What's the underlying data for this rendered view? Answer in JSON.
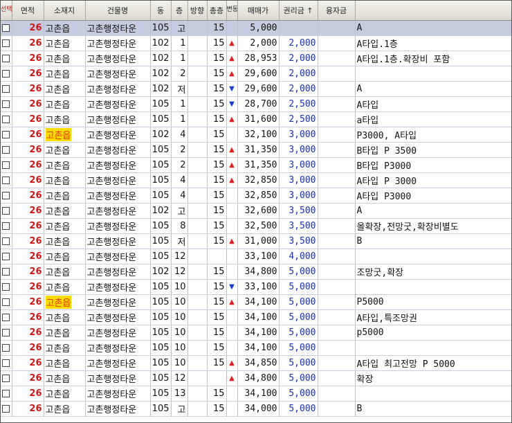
{
  "headers": {
    "select": "선택",
    "area": "면적",
    "location": "소재지",
    "building": "건물명",
    "dong": "동",
    "floor": "층",
    "direction": "방향",
    "total_floors": "총층",
    "trend": "변동",
    "sale_price": "매매가",
    "premium": "권리금 ↑",
    "loan": "융자금",
    "memo": ""
  },
  "colors": {
    "area_red": "#d01818",
    "premium_blue": "#1a2fb0",
    "highlight_yellow": "#ffdc00",
    "selected_row": "#c6cce0",
    "up_arrow": "#e02020",
    "down_arrow": "#1a3fd0"
  },
  "rows": [
    {
      "area": "26",
      "location": "고촌읍",
      "highlight": false,
      "building": "고촌행정타운",
      "dong": "105",
      "floor": "고",
      "direction": "",
      "total": "15",
      "trend": "",
      "price": "5,000",
      "premium": "",
      "loan": "",
      "memo": "A",
      "selected": true
    },
    {
      "area": "26",
      "location": "고촌읍",
      "highlight": false,
      "building": "고촌행정타운",
      "dong": "102",
      "floor": "1",
      "direction": "",
      "total": "15",
      "trend": "▲",
      "price": "2,000",
      "premium": "2,000",
      "loan": "",
      "memo": "A타입.1층",
      "selected": false
    },
    {
      "area": "26",
      "location": "고촌읍",
      "highlight": false,
      "building": "고촌행정타운",
      "dong": "102",
      "floor": "1",
      "direction": "",
      "total": "15",
      "trend": "▲",
      "price": "28,953",
      "premium": "2,000",
      "loan": "",
      "memo": "A타입.1층.확장비 포함",
      "selected": false
    },
    {
      "area": "26",
      "location": "고촌읍",
      "highlight": false,
      "building": "고촌행정타운",
      "dong": "102",
      "floor": "2",
      "direction": "",
      "total": "15",
      "trend": "▲",
      "price": "29,600",
      "premium": "2,000",
      "loan": "",
      "memo": "",
      "selected": false
    },
    {
      "area": "26",
      "location": "고촌읍",
      "highlight": false,
      "building": "고촌행정타운",
      "dong": "102",
      "floor": "저",
      "direction": "",
      "total": "15",
      "trend": "▼",
      "price": "29,600",
      "premium": "2,000",
      "loan": "",
      "memo": "A",
      "selected": false
    },
    {
      "area": "26",
      "location": "고촌읍",
      "highlight": false,
      "building": "고촌행정타운",
      "dong": "105",
      "floor": "1",
      "direction": "",
      "total": "15",
      "trend": "▼",
      "price": "28,700",
      "premium": "2,500",
      "loan": "",
      "memo": "A타입",
      "selected": false
    },
    {
      "area": "26",
      "location": "고촌읍",
      "highlight": false,
      "building": "고촌행정타운",
      "dong": "105",
      "floor": "1",
      "direction": "",
      "total": "15",
      "trend": "▲",
      "price": "31,600",
      "premium": "2,500",
      "loan": "",
      "memo": "a타입",
      "selected": false
    },
    {
      "area": "26",
      "location": "고촌읍",
      "highlight": true,
      "building": "고촌행정타운",
      "dong": "102",
      "floor": "4",
      "direction": "",
      "total": "15",
      "trend": "",
      "price": "32,100",
      "premium": "3,000",
      "loan": "",
      "memo": "P3000, A타입",
      "selected": false
    },
    {
      "area": "26",
      "location": "고촌읍",
      "highlight": false,
      "building": "고촌행정타운",
      "dong": "105",
      "floor": "2",
      "direction": "",
      "total": "15",
      "trend": "▲",
      "price": "31,350",
      "premium": "3,000",
      "loan": "",
      "memo": "B타입  P 3500",
      "selected": false
    },
    {
      "area": "26",
      "location": "고촌읍",
      "highlight": false,
      "building": "고촌행정타운",
      "dong": "105",
      "floor": "2",
      "direction": "",
      "total": "15",
      "trend": "▲",
      "price": "31,350",
      "premium": "3,000",
      "loan": "",
      "memo": "B타입 P3000",
      "selected": false
    },
    {
      "area": "26",
      "location": "고촌읍",
      "highlight": false,
      "building": "고촌행정타운",
      "dong": "105",
      "floor": "4",
      "direction": "",
      "total": "15",
      "trend": "▲",
      "price": "32,850",
      "premium": "3,000",
      "loan": "",
      "memo": "A타입  P 3000",
      "selected": false
    },
    {
      "area": "26",
      "location": "고촌읍",
      "highlight": false,
      "building": "고촌행정타운",
      "dong": "105",
      "floor": "4",
      "direction": "",
      "total": "15",
      "trend": "",
      "price": "32,850",
      "premium": "3,000",
      "loan": "",
      "memo": "A타입 P3000",
      "selected": false
    },
    {
      "area": "26",
      "location": "고촌읍",
      "highlight": false,
      "building": "고촌행정타운",
      "dong": "102",
      "floor": "고",
      "direction": "",
      "total": "15",
      "trend": "",
      "price": "32,600",
      "premium": "3,500",
      "loan": "",
      "memo": "A",
      "selected": false
    },
    {
      "area": "26",
      "location": "고촌읍",
      "highlight": false,
      "building": "고촌행정타운",
      "dong": "105",
      "floor": "8",
      "direction": "",
      "total": "15",
      "trend": "",
      "price": "32,500",
      "premium": "3,500",
      "loan": "",
      "memo": "올확장,전망굿,확장비별도",
      "selected": false
    },
    {
      "area": "26",
      "location": "고촌읍",
      "highlight": false,
      "building": "고촌행정타운",
      "dong": "105",
      "floor": "저",
      "direction": "",
      "total": "15",
      "trend": "▲",
      "price": "31,000",
      "premium": "3,500",
      "loan": "",
      "memo": "B",
      "selected": false
    },
    {
      "area": "26",
      "location": "고촌읍",
      "highlight": false,
      "building": "고촌행정타운",
      "dong": "105",
      "floor": "12",
      "direction": "",
      "total": "",
      "trend": "",
      "price": "33,100",
      "premium": "4,000",
      "loan": "",
      "memo": "",
      "selected": false
    },
    {
      "area": "26",
      "location": "고촌읍",
      "highlight": false,
      "building": "고촌행정타운",
      "dong": "102",
      "floor": "12",
      "direction": "",
      "total": "15",
      "trend": "",
      "price": "34,800",
      "premium": "5,000",
      "loan": "",
      "memo": "조망굿,확장",
      "selected": false
    },
    {
      "area": "26",
      "location": "고촌읍",
      "highlight": false,
      "building": "고촌행정타운",
      "dong": "105",
      "floor": "10",
      "direction": "",
      "total": "15",
      "trend": "▼",
      "price": "33,100",
      "premium": "5,000",
      "loan": "",
      "memo": "",
      "selected": false
    },
    {
      "area": "26",
      "location": "고촌읍",
      "highlight": true,
      "building": "고촌행정타운",
      "dong": "105",
      "floor": "10",
      "direction": "",
      "total": "15",
      "trend": "▲",
      "price": "34,100",
      "premium": "5,000",
      "loan": "",
      "memo": "P5000",
      "selected": false
    },
    {
      "area": "26",
      "location": "고촌읍",
      "highlight": false,
      "building": "고촌행정타운",
      "dong": "105",
      "floor": "10",
      "direction": "",
      "total": "15",
      "trend": "",
      "price": "34,100",
      "premium": "5,000",
      "loan": "",
      "memo": "A타입,특조망권",
      "selected": false
    },
    {
      "area": "26",
      "location": "고촌읍",
      "highlight": false,
      "building": "고촌행정타운",
      "dong": "105",
      "floor": "10",
      "direction": "",
      "total": "15",
      "trend": "",
      "price": "34,100",
      "premium": "5,000",
      "loan": "",
      "memo": "p5000",
      "selected": false
    },
    {
      "area": "26",
      "location": "고촌읍",
      "highlight": false,
      "building": "고촌행정타운",
      "dong": "105",
      "floor": "10",
      "direction": "",
      "total": "15",
      "trend": "",
      "price": "34,100",
      "premium": "5,000",
      "loan": "",
      "memo": "",
      "selected": false
    },
    {
      "area": "26",
      "location": "고촌읍",
      "highlight": false,
      "building": "고촌행정타운",
      "dong": "105",
      "floor": "10",
      "direction": "",
      "total": "15",
      "trend": "▲",
      "price": "34,850",
      "premium": "5,000",
      "loan": "",
      "memo": "A타입 최고전망 P 5000",
      "selected": false
    },
    {
      "area": "26",
      "location": "고촌읍",
      "highlight": false,
      "building": "고촌행정타운",
      "dong": "105",
      "floor": "12",
      "direction": "",
      "total": "",
      "trend": "▲",
      "price": "34,800",
      "premium": "5,000",
      "loan": "",
      "memo": "확장",
      "selected": false
    },
    {
      "area": "26",
      "location": "고촌읍",
      "highlight": false,
      "building": "고촌행정타운",
      "dong": "105",
      "floor": "13",
      "direction": "",
      "total": "15",
      "trend": "",
      "price": "34,100",
      "premium": "5,000",
      "loan": "",
      "memo": "",
      "selected": false
    },
    {
      "area": "26",
      "location": "고촌읍",
      "highlight": false,
      "building": "고촌행정타운",
      "dong": "105",
      "floor": "고",
      "direction": "",
      "total": "15",
      "trend": "",
      "price": "34,000",
      "premium": "5,000",
      "loan": "",
      "memo": "B",
      "selected": false
    }
  ]
}
